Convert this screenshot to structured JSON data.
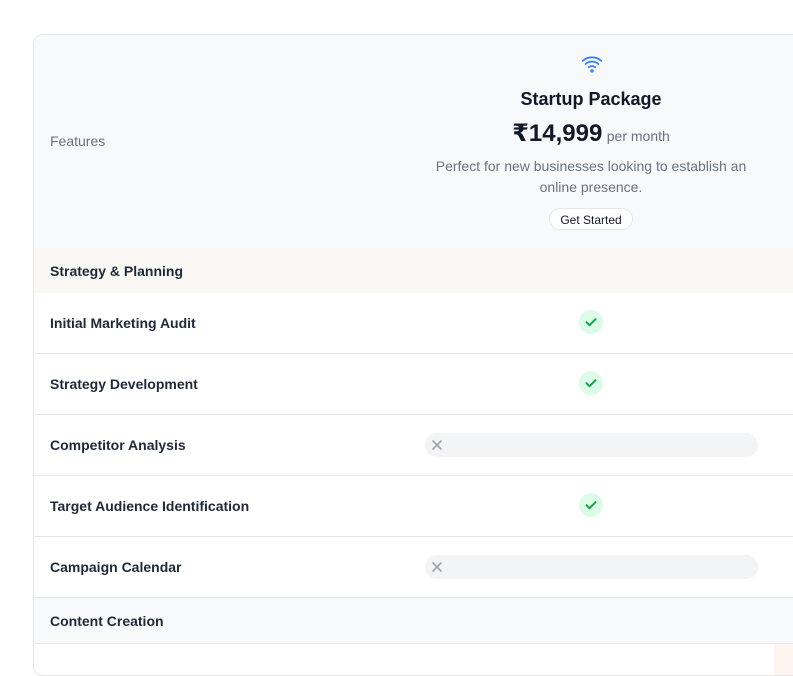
{
  "header": {
    "features_label": "Features",
    "package": {
      "icon": "wifi-icon",
      "name": "Startup Package",
      "price": "₹14,999",
      "per": "per month",
      "description": "Perfect for new businesses looking to establish an online presence.",
      "cta": "Get Started"
    }
  },
  "sections": [
    {
      "title": "Strategy & Planning",
      "features": [
        {
          "label": "Initial Marketing Audit",
          "included": true
        },
        {
          "label": "Strategy Development",
          "included": true
        },
        {
          "label": "Competitor Analysis",
          "included": false
        },
        {
          "label": "Target Audience Identification",
          "included": true
        },
        {
          "label": "Campaign Calendar",
          "included": false
        }
      ]
    },
    {
      "title": "Content Creation",
      "features": []
    }
  ],
  "colors": {
    "accent": "#3b82f6",
    "check_bg": "#dcfce7",
    "check": "#16a34a",
    "cross": "#9ca3af"
  }
}
